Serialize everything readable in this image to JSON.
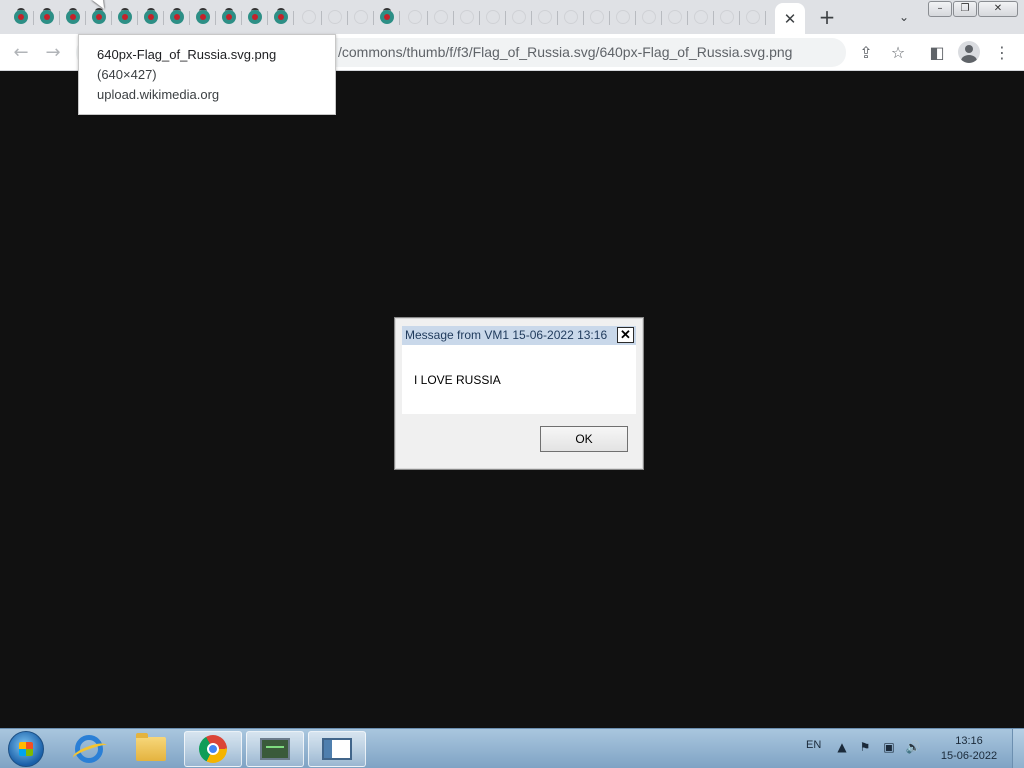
{
  "browser": {
    "url": "/commons/thumb/f/f3/Flag_of_Russia.svg/640px-Flag_of_Russia.svg.png",
    "active_tab_close": "✕",
    "new_tab": "+",
    "tab_search": "⌄"
  },
  "tooltip": {
    "title": "640px-Flag_of_Russia.svg.png",
    "dimensions": "(640×427)",
    "domain": "upload.wikimedia.org"
  },
  "dialog": {
    "title": "Message from VM1 15-06-2022 13:16",
    "message": "I LOVE RUSSIA",
    "ok_label": "OK",
    "close_label": "✕"
  },
  "taskbar": {
    "language": "EN",
    "time": "13:16",
    "date": "15-06-2022"
  },
  "window_controls": {
    "minimize": "–",
    "restore": "❐",
    "close": "✕"
  }
}
